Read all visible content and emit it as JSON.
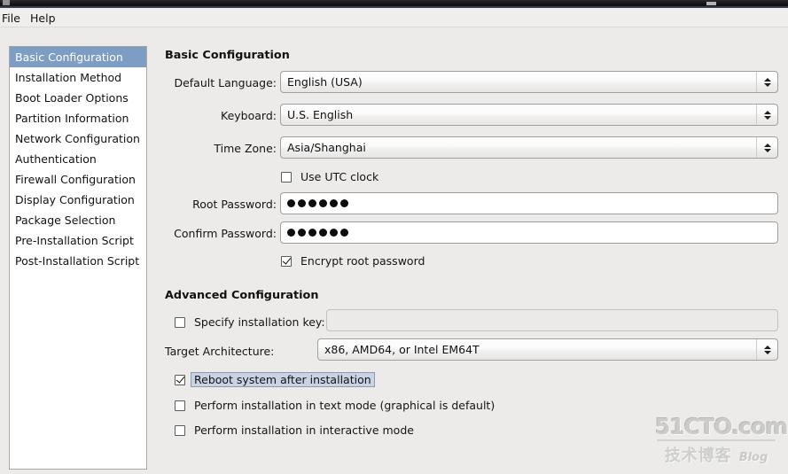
{
  "window": {
    "titlebar_icon": "window-icon"
  },
  "menubar": {
    "file": "File",
    "help": "Help"
  },
  "sidebar": {
    "items": [
      {
        "label": "Basic Configuration",
        "selected": true
      },
      {
        "label": "Installation Method",
        "selected": false
      },
      {
        "label": "Boot Loader Options",
        "selected": false
      },
      {
        "label": "Partition Information",
        "selected": false
      },
      {
        "label": "Network Configuration",
        "selected": false
      },
      {
        "label": "Authentication",
        "selected": false
      },
      {
        "label": "Firewall Configuration",
        "selected": false
      },
      {
        "label": "Display Configuration",
        "selected": false
      },
      {
        "label": "Package Selection",
        "selected": false
      },
      {
        "label": "Pre-Installation Script",
        "selected": false
      },
      {
        "label": "Post-Installation Script",
        "selected": false
      }
    ]
  },
  "basic": {
    "title": "Basic Configuration",
    "default_language_label": "Default Language:",
    "default_language_value": "English (USA)",
    "keyboard_label": "Keyboard:",
    "keyboard_value": "U.S. English",
    "timezone_label": "Time Zone:",
    "timezone_value": "Asia/Shanghai",
    "utc_label": "Use UTC clock",
    "utc_checked": false,
    "root_password_label": "Root Password:",
    "root_password_dots": 6,
    "confirm_password_label": "Confirm Password:",
    "confirm_password_dots": 6,
    "encrypt_label": "Encrypt root password",
    "encrypt_checked": true
  },
  "advanced": {
    "title": "Advanced Configuration",
    "install_key_label": "Specify installation key:",
    "install_key_checked": false,
    "install_key_value": "",
    "target_arch_label": "Target Architecture:",
    "target_arch_value": "x86, AMD64, or Intel EM64T",
    "reboot_label": "Reboot system after installation",
    "reboot_checked": true,
    "reboot_focused": true,
    "text_mode_label": "Perform installation in text mode (graphical is default)",
    "text_mode_checked": false,
    "interactive_label": "Perform installation in interactive mode",
    "interactive_checked": false
  },
  "watermark": {
    "top": "51CTO.com",
    "cn": "技术博客",
    "blog": "Blog"
  },
  "colors": {
    "selection": "#7d9dc4",
    "background": "#ecebe9",
    "panel": "#ffffff",
    "focus_ring": "#c9d3e4"
  }
}
